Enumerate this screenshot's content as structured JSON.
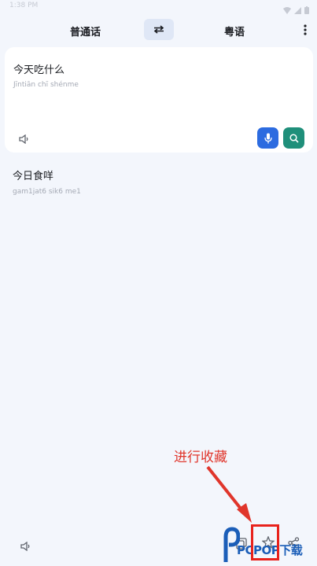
{
  "status": {
    "time": "1:38 PM"
  },
  "header": {
    "source_lang": "普通话",
    "target_lang": "粤语"
  },
  "input": {
    "text": "今天吃什么",
    "pinyin": "Jīntiān chī shénme"
  },
  "result": {
    "text": "今日食咩",
    "jyutping": "gam1jat6 sik6 me1"
  },
  "annotation": {
    "label": "进行收藏"
  },
  "watermark": {
    "text": "PCPOP下载"
  },
  "colors": {
    "mic_button": "#2c6be0",
    "search_button": "#1f8f7a",
    "annotation": "#e0352b",
    "swap_button_bg": "#dfe7f6"
  },
  "icons": {
    "swap": "swap-arrows-icon",
    "menu": "more-vertical-icon",
    "speaker": "speaker-icon",
    "mic": "microphone-icon",
    "search": "search-icon",
    "copy": "copy-icon",
    "favorite": "star-icon",
    "share": "share-icon"
  }
}
